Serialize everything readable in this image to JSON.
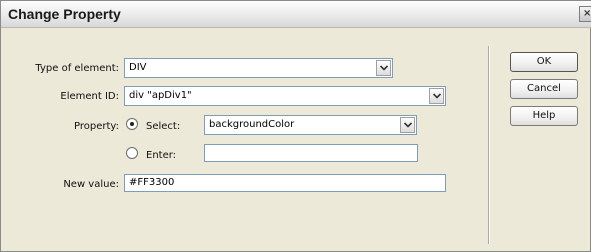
{
  "window": {
    "title": "Change Property",
    "close_glyph": "×"
  },
  "form": {
    "type_label": "Type of element:",
    "type_value": "DIV",
    "element_id_label": "Element ID:",
    "element_id_value": "div \"apDiv1\"",
    "property_label": "Property:",
    "select_radio_label": "Select:",
    "select_value": "backgroundColor",
    "select_checked": true,
    "enter_radio_label": "Enter:",
    "enter_value": "",
    "enter_checked": false,
    "new_value_label": "New value:",
    "new_value": "#FF3300"
  },
  "buttons": {
    "ok": "OK",
    "cancel": "Cancel",
    "help": "Help"
  },
  "icons": {
    "close": "close-icon",
    "dropdown": "chevron-down-icon",
    "radio_selected": "radio-selected-icon",
    "radio_unselected": "radio-unselected-icon"
  }
}
